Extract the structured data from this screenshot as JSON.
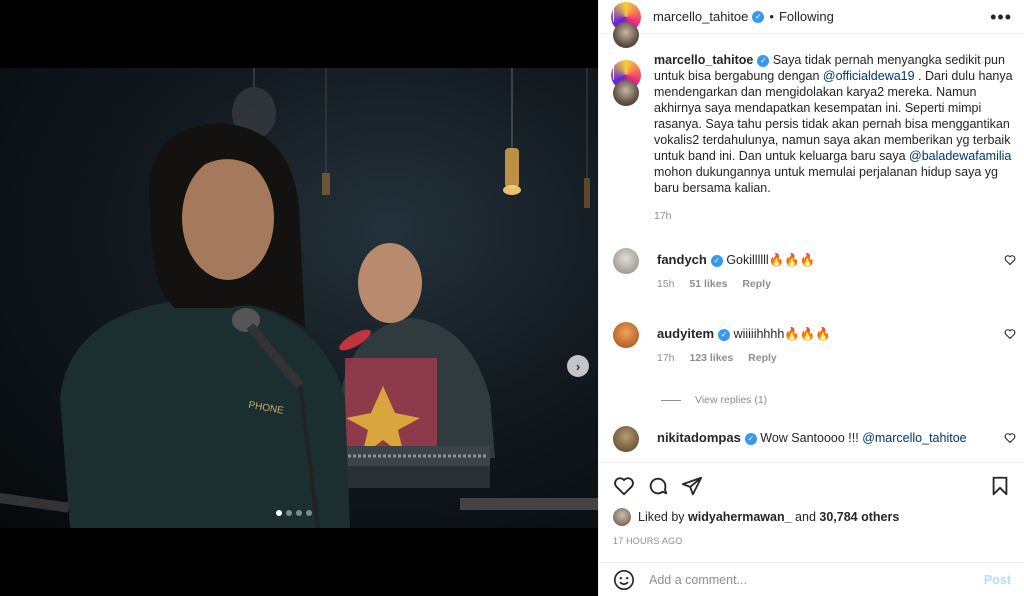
{
  "post": {
    "author": "marcello_tahitoe",
    "follow_status": "Following",
    "more_label": "•••",
    "caption": {
      "text_1": "Saya tidak pernah menyangka sedikit pun untuk bisa bergabung dengan ",
      "mention_1": "@officialdewa19",
      "text_2": " . Dari dulu hanya mendengarkan dan mengidolakan karya2 mereka. Namun akhirnya saya mendapatkan kesempatan ini. Seperti mimpi rasanya. Saya tahu persis tidak akan pernah bisa menggantikan vokalis2 terdahulunya, namun saya akan memberikan yg terbaik untuk band ini. Dan untuk keluarga baru saya ",
      "mention_2": "@baladewafamilia",
      "text_3": " mohon dukungannya untuk memulai perjalanan hidup saya yg baru bersama kalian.",
      "time": "17h"
    },
    "carousel": {
      "next_label": "›",
      "count": 4,
      "active_index": 0
    }
  },
  "comments": [
    {
      "user": "fandych",
      "text": "Gokillllll",
      "emoji": "🔥🔥🔥",
      "time": "15h",
      "likes": "51 likes",
      "reply": "Reply"
    },
    {
      "user": "audyitem",
      "text": "wiiiiihhhh",
      "emoji": "🔥🔥🔥",
      "time": "17h",
      "likes": "123 likes",
      "reply": "Reply",
      "view_replies": "View replies (1)"
    },
    {
      "user": "nikitadompas",
      "text": "Wow Santoooo !!! ",
      "mention": "@marcello_tahitoe"
    }
  ],
  "likes": {
    "prefix": "Liked by ",
    "liker": "widyahermawan_",
    "middle": " and ",
    "count": "30,784 others"
  },
  "timestamp": "17 HOURS AGO",
  "add_comment": {
    "placeholder": "Add a comment...",
    "post_label": "Post"
  },
  "colors": {
    "verified": "#3897f0",
    "mention": "#00376b",
    "post_disabled": "#b2dffc"
  }
}
